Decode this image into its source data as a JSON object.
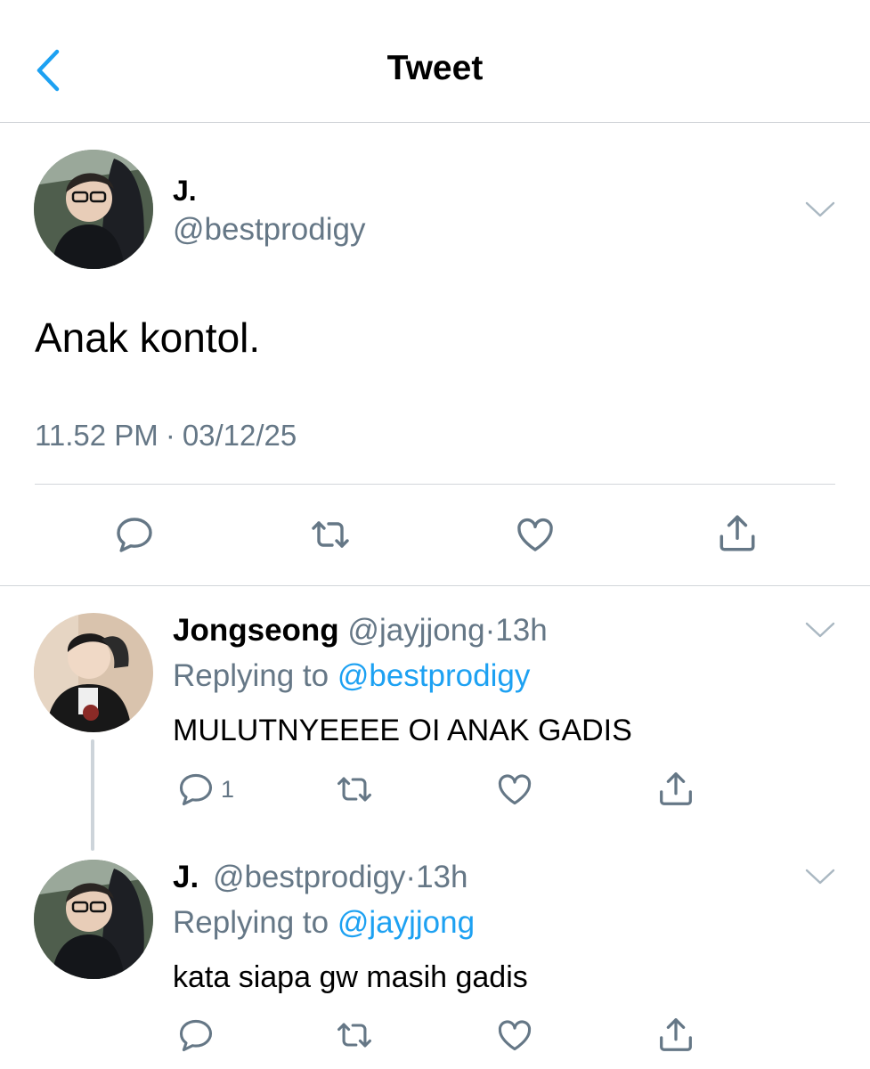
{
  "header": {
    "title": "Tweet",
    "accent_color": "#1da1f2"
  },
  "main_tweet": {
    "name": "J.",
    "handle": "@bestprodigy",
    "text": "Anak kontol.",
    "time": "11.52 PM",
    "separator": "·",
    "date": "03/12/25"
  },
  "replies": [
    {
      "name": "Jongseong",
      "handle": "@jayjjong",
      "separator": "·",
      "time": "13h",
      "replying_prefix": "Replying to",
      "replying_to": "@bestprodigy",
      "text": "MULUTNYEEEE OI ANAK GADIS",
      "reply_count": "1"
    },
    {
      "name": "J.",
      "handle": "@bestprodigy",
      "separator": "·",
      "time": "13h",
      "replying_prefix": "Replying to",
      "replying_to": "@jayjjong",
      "text": "kata siapa gw masih gadis",
      "reply_count": ""
    }
  ],
  "icons": {
    "back": "chevron-left-icon",
    "more": "chevron-down-icon",
    "reply": "comment-icon",
    "retweet": "retweet-icon",
    "like": "heart-icon",
    "share": "share-icon"
  }
}
